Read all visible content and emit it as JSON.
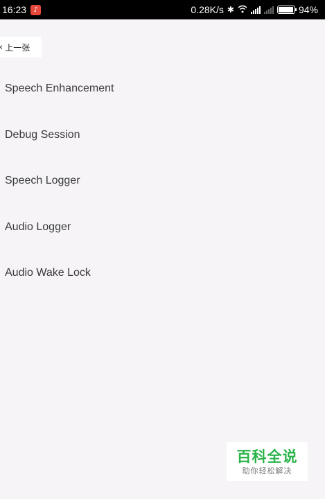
{
  "status_bar": {
    "time": "16:23",
    "notification_icon": "app-notification-icon",
    "net_speed": "0.28K/s",
    "battery_percent": "94%",
    "battery_level": 0.94,
    "icons": [
      "bluetooth-icon",
      "wifi-icon",
      "signal-icon",
      "signal-no-sim-icon",
      "battery-icon"
    ]
  },
  "nav": {
    "back_label": "上一张"
  },
  "menu": {
    "items": [
      {
        "label": "Speech Enhancement"
      },
      {
        "label": "Debug Session"
      },
      {
        "label": "Speech Logger"
      },
      {
        "label": "Audio Logger"
      },
      {
        "label": "Audio Wake Lock"
      }
    ]
  },
  "watermark": {
    "title": "百科全说",
    "subtitle": "助你轻松解决"
  },
  "colors": {
    "background": "#f6f4f7",
    "status_bar": "#000000",
    "watermark_green": "#2ab34a",
    "text": "#3a3a3a"
  }
}
